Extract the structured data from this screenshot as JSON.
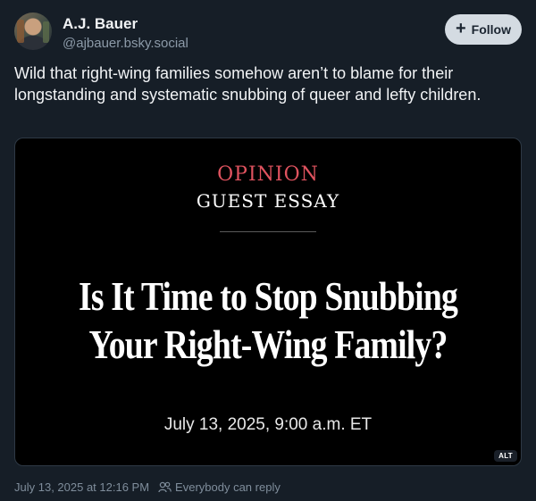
{
  "author": {
    "display_name": "A.J. Bauer",
    "handle": "@ajbauer.bsky.social",
    "avatar_icon": "profile-photo"
  },
  "follow": {
    "label": "Follow",
    "icon": "plus-icon"
  },
  "post": {
    "text": "Wild that right-wing families somehow aren’t to blame for their longstanding and systematic snubbing of queer and lefty children."
  },
  "embed": {
    "section": "OPINION",
    "kicker": "GUEST ESSAY",
    "headline_line1": "Is It Time to Stop Snubbing",
    "headline_line2": "Your Right-Wing Family?",
    "date": "July 13, 2025, 9:00 a.m. ET",
    "alt_badge": "ALT"
  },
  "footer": {
    "timestamp": "July 13, 2025 at 12:16 PM",
    "reply_setting": "Everybody can reply"
  },
  "colors": {
    "background": "#161e27",
    "opinion_red": "#e0535f",
    "follow_bg": "#d4dbe2",
    "muted_text": "#8c9aa8"
  }
}
